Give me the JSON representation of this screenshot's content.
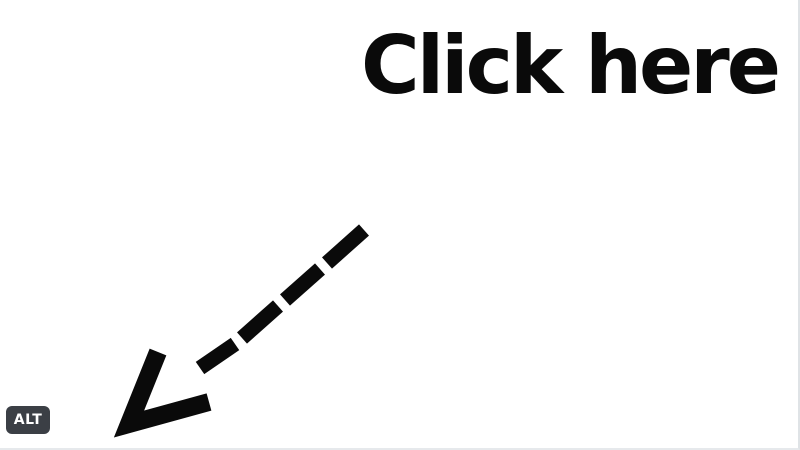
{
  "image": {
    "headline": "Click here",
    "arrow_icon": "dashed-arrow-down-left-icon",
    "text_color": "#0a0a0a",
    "background_color": "#ffffff"
  },
  "badge": {
    "label": "ALT",
    "color": "#3b3f45"
  }
}
